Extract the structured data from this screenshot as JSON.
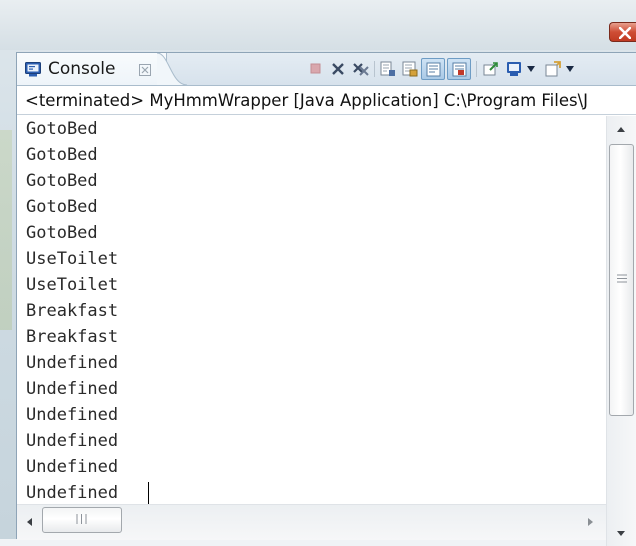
{
  "window": {
    "close_icon": "close-icon",
    "colors": {
      "close_button": "#cf4d35",
      "frame": "#cfdce4"
    }
  },
  "view": {
    "tab": {
      "label": "Console",
      "close_glyph": "⊠",
      "icon": "console-icon"
    },
    "toolbar": {
      "icons": [
        "terminate-icon",
        "remove-launch-icon",
        "remove-all-terminated-icon",
        "clear-console-icon",
        "scroll-lock-icon",
        "word-wrap-icon",
        "show-console-on-output-icon",
        "pin-console-icon",
        "display-selected-console-icon",
        "display-console-dropdown-icon",
        "open-console-icon",
        "open-console-dropdown-icon"
      ]
    },
    "status": "<terminated> MyHmmWrapper [Java Application] C:\\Program Files\\J",
    "output_lines": [
      "GotoBed",
      "GotoBed",
      "GotoBed",
      "GotoBed",
      "GotoBed",
      "UseToilet",
      "UseToilet",
      "Breakfast",
      "Breakfast",
      "Undefined",
      "Undefined",
      "Undefined",
      "Undefined",
      "Undefined",
      "Undefined"
    ],
    "scroll": {
      "vertical_thumb_fraction": 0.66,
      "horizontal_thumb_fraction": 0.14
    }
  }
}
